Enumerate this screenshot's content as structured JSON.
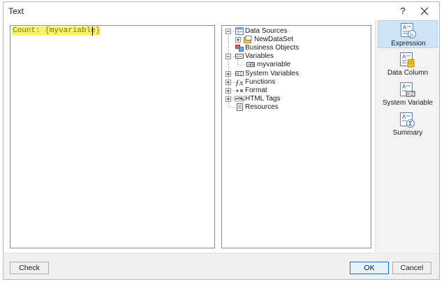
{
  "window": {
    "title": "Text",
    "help_label": "?"
  },
  "editor": {
    "content": "Count: {myvariable}"
  },
  "tree": {
    "items": [
      {
        "label": "Data Sources",
        "icon": "data-sources-icon"
      },
      {
        "label": "NewDataSet",
        "icon": "dataset-icon"
      },
      {
        "label": "Business Objects",
        "icon": "business-objects-icon"
      },
      {
        "label": "Variables",
        "icon": "variables-icon"
      },
      {
        "label": "myvariable",
        "icon": "variable-123-icon"
      },
      {
        "label": "System Variables",
        "icon": "system-variables-icon"
      },
      {
        "label": "Functions",
        "icon": "fx-icon"
      },
      {
        "label": "Format",
        "icon": "format-icon"
      },
      {
        "label": "HTML Tags",
        "icon": "html-icon"
      },
      {
        "label": "Resources",
        "icon": "resources-icon"
      }
    ]
  },
  "side": {
    "buttons": [
      {
        "label": "Expression",
        "icon": "expression-icon",
        "active": true
      },
      {
        "label": "Data Column",
        "icon": "data-column-icon"
      },
      {
        "label": "System Variable",
        "icon": "system-variable-icon"
      },
      {
        "label": "Summary",
        "icon": "summary-icon"
      }
    ]
  },
  "footer": {
    "check_label": "Check",
    "ok_label": "OK",
    "cancel_label": "Cancel"
  },
  "colors": {
    "highlight": "#fbf36c",
    "active_tab": "#cfe3f7",
    "accent": "#0078d7"
  }
}
